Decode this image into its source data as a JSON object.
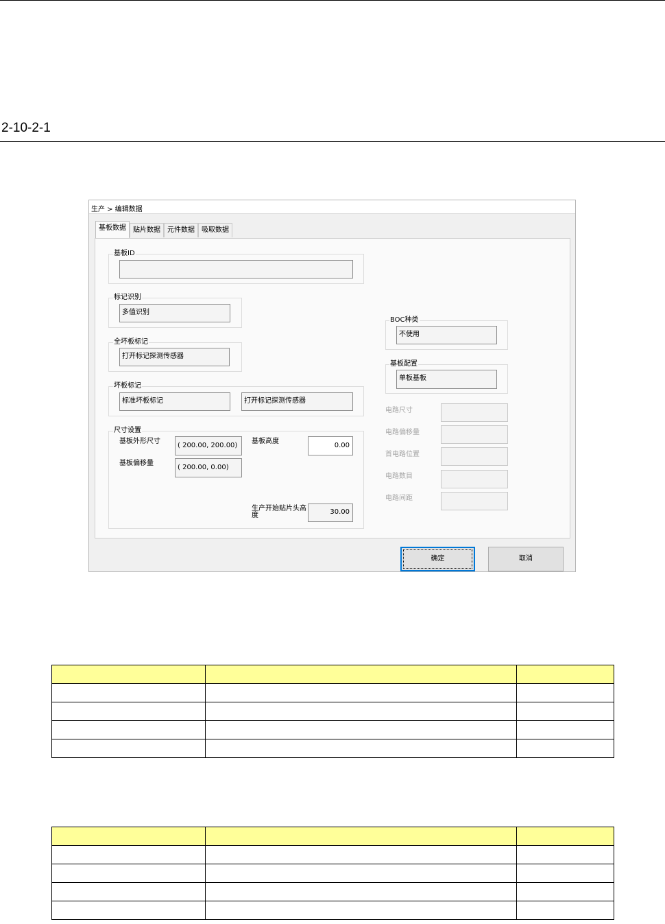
{
  "document": {
    "section_number": "2-10-2-1"
  },
  "dialog": {
    "breadcrumb": "生产 > 编辑数据",
    "tabs": [
      {
        "label": "基板数据",
        "active": true
      },
      {
        "label": "贴片数据",
        "active": false
      },
      {
        "label": "元件数据",
        "active": false
      },
      {
        "label": "吸取数据",
        "active": false
      }
    ],
    "board_id": {
      "label": "基板ID",
      "value": ""
    },
    "mark_recognition": {
      "label": "标记识别",
      "value": "多值识别"
    },
    "all_bad_mark": {
      "label": "全坏板标记",
      "value": "打开标记探测传感器"
    },
    "bad_mark": {
      "label": "坏板标记",
      "value1": "标准坏板标记",
      "value2": "打开标记探测传感器"
    },
    "size_settings": {
      "label": "尺寸设置",
      "outline_label": "基板外形尺寸",
      "outline_value": "( 200.00, 200.00)",
      "offset_label": "基板偏移量",
      "offset_value": "( 200.00,   0.00)",
      "height_label": "基板高度",
      "height_value": "0.00",
      "head_height_label": "生产开始贴片头高度",
      "head_height_value": "30.00"
    },
    "boc_type": {
      "label": "BOC种类",
      "value": "不使用"
    },
    "board_config": {
      "label": "基板配置",
      "value": "单板基板"
    },
    "circuit": [
      {
        "label": "电路尺寸",
        "value": ""
      },
      {
        "label": "电路偏移量",
        "value": ""
      },
      {
        "label": "首电路位置",
        "value": ""
      },
      {
        "label": "电路数目",
        "value": ""
      },
      {
        "label": "电路间距",
        "value": ""
      }
    ],
    "ok_label": "确定",
    "cancel_label": "取消"
  },
  "tables": [
    {
      "rows": 4
    },
    {
      "rows": 4
    }
  ],
  "colors": {
    "table_header": "#ffff99",
    "focus_border": "#0078d7"
  }
}
